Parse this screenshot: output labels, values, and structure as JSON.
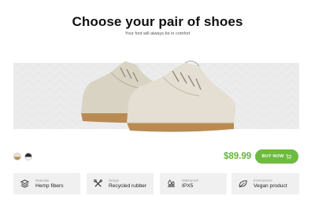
{
  "header": {
    "title": "Choose your pair of shoes",
    "subtitle": "Your foot will always be in comfort"
  },
  "product": {
    "image_icon": "sneaker-image",
    "colors": [
      {
        "name": "beige",
        "hex": "#e9e2d2",
        "sole": "#b98a52"
      },
      {
        "name": "black",
        "hex": "#2b2b2b",
        "sole": "#f5f5f5"
      }
    ],
    "price": "$89.99",
    "price_color": "#64b53a",
    "buy_label": "BUY NOW",
    "buy_icon": "cart-icon",
    "accent": "#6dbb3f"
  },
  "features": [
    {
      "label": "Materials",
      "value": "Hemp fibers",
      "icon": "layers-icon"
    },
    {
      "label": "Design",
      "value": "Recycled rubber",
      "icon": "tools-icon"
    },
    {
      "label": "Waterproof",
      "value": "IPX5",
      "icon": "water-drops-icon"
    },
    {
      "label": "Environment",
      "value": "Vegan product",
      "icon": "leaf-icon"
    }
  ]
}
